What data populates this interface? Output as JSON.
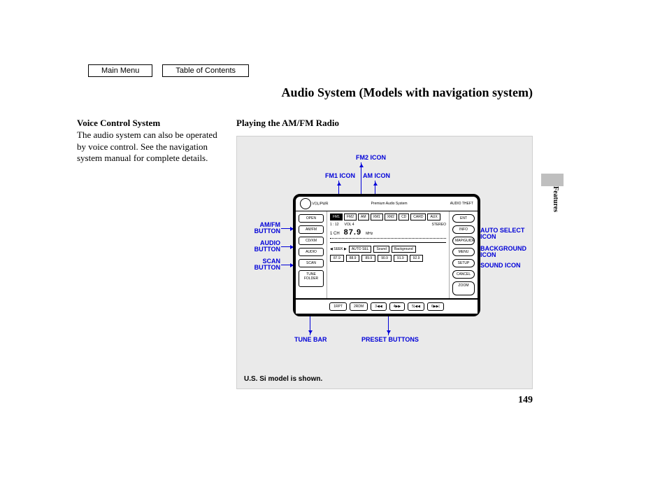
{
  "nav": {
    "main_menu": "Main Menu",
    "toc": "Table of Contents"
  },
  "title": "Audio System (Models with navigation system)",
  "side_tab": "Features",
  "page_number": "149",
  "voice": {
    "heading": "Voice Control System",
    "body": "The audio system can also be operated by voice control. See the navigation system manual for complete details."
  },
  "section_heading": "Playing the AM/FM Radio",
  "caption": "U.S. Si model is shown.",
  "callouts": {
    "fm2": "FM2 ICON",
    "fm1": "FM1 ICON",
    "am": "AM ICON",
    "amfm_btn": "AM/FM BUTTON",
    "audio_btn": "AUDIO BUTTON",
    "scan_btn": "SCAN BUTTON",
    "autosel": "AUTO SELECT ICON",
    "bg": "BACKGROUND ICON",
    "sound": "SOUND ICON",
    "tune": "TUNE BAR",
    "preset": "PRESET BUTTONS"
  },
  "unit": {
    "top_left": "VOL/PWR",
    "top_mid": "Premium Audio System",
    "top_right": "AUDIO THEFT",
    "left_btns": [
      "OPEN",
      "AM/FM",
      "CD/XM",
      "AUDIO",
      "SCAN"
    ],
    "tune_label": "TUNE FOLDER",
    "tabs": [
      "FM1",
      "FM2",
      "AM",
      "XM1",
      "XM2",
      "CD",
      "CARD",
      "AUX"
    ],
    "time": "1 : 12",
    "vol": "VOL 4",
    "stereo": "STEREO",
    "ch": "1 CH",
    "freq": "87.9",
    "mhz": "MHz",
    "seek": "SEEK",
    "soft_btns": [
      "AUTO SEL",
      "Sound",
      "Background"
    ],
    "presets": [
      "87.9",
      "88.9",
      "89.9",
      "90.9",
      "91.9",
      "92.9"
    ],
    "right_btns": [
      "ENT",
      "INFO",
      "MAP/GUIDE",
      "MENU",
      "SETUP",
      "CANCEL"
    ],
    "zoom": "ZOOM",
    "foot_btns": [
      "1RPT",
      "2RDM",
      "3◀◀",
      "4▶▶",
      "5|◀◀",
      "6▶▶|"
    ]
  }
}
